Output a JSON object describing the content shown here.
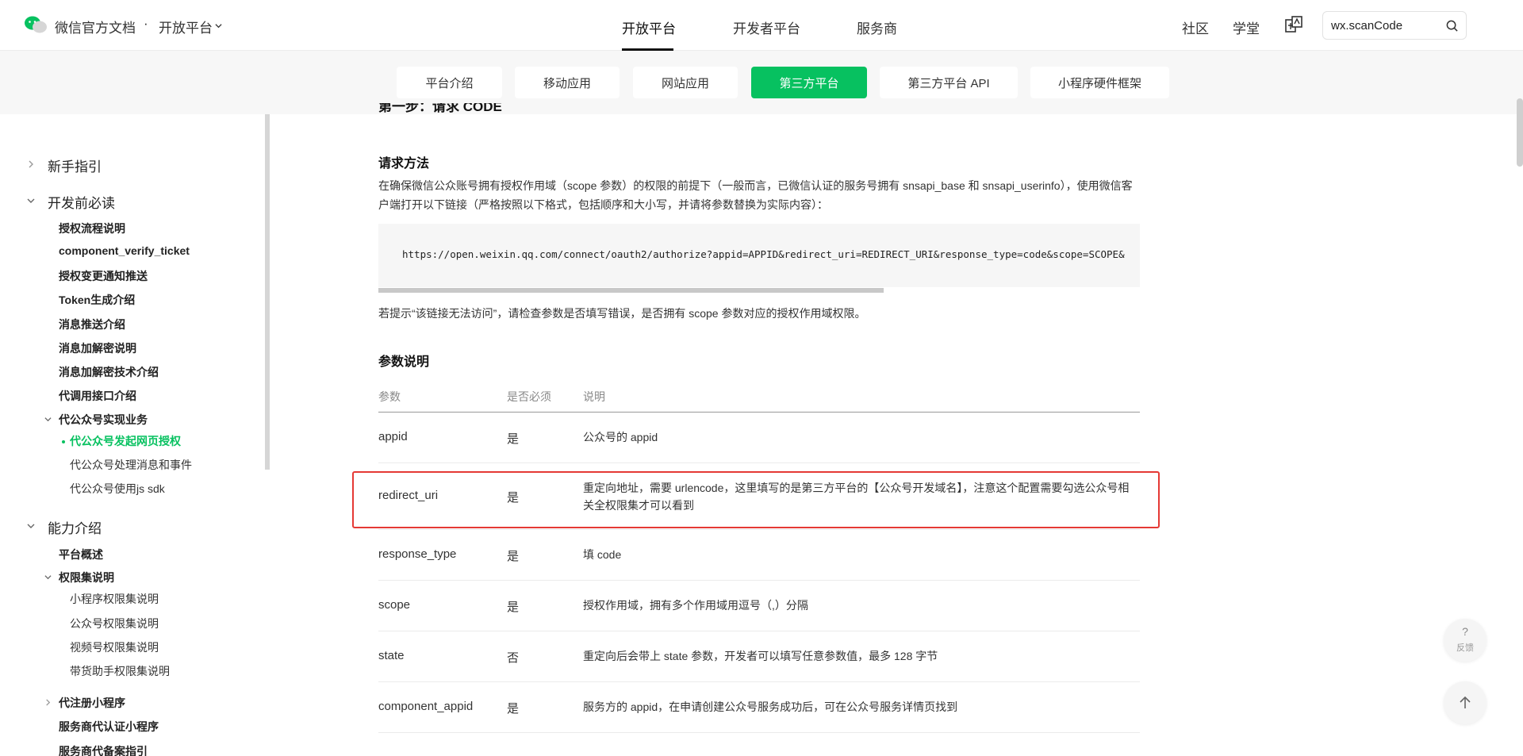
{
  "header": {
    "brand": "微信官方文档",
    "separator": "·",
    "platform": "开放平台",
    "nav": [
      "开放平台",
      "开发者平台",
      "服务商"
    ],
    "right_links": [
      "社区",
      "学堂"
    ],
    "search_value": "wx.scanCode"
  },
  "subtabs": [
    "平台介绍",
    "移动应用",
    "网站应用",
    "第三方平台",
    "第三方平台 API",
    "小程序硬件框架"
  ],
  "active_subtab": "第三方平台",
  "sidebar": {
    "sections": [
      "新手指引",
      "开发前必读",
      "能力介绍"
    ],
    "dev_items": [
      "授权流程说明",
      "component_verify_ticket",
      "授权变更通知推送",
      "Token生成介绍",
      "消息推送介绍",
      "消息加解密说明",
      "消息加解密技术介绍",
      "代调用接口介绍",
      "代公众号实现业务"
    ],
    "dev_subitems": [
      "代公众号发起网页授权",
      "代公众号处理消息和事件",
      "代公众号使用js sdk"
    ],
    "ability_items": [
      "平台概述",
      "权限集说明"
    ],
    "ability_subitems": [
      "小程序权限集说明",
      "公众号权限集说明",
      "视频号权限集说明",
      "带货助手权限集说明"
    ],
    "ability_more": [
      "代注册小程序",
      "服务商代认证小程序",
      "服务商代备案指引"
    ]
  },
  "content": {
    "cut_heading": "第一步：请求 CODE",
    "h_request": "请求方法",
    "p_request": "在确保微信公众账号拥有授权作用域（scope 参数）的权限的前提下（一般而言，已微信认证的服务号拥有 snsapi_base 和 snsapi_userinfo），使用微信客户端打开以下链接（严格按照以下格式，包括顺序和大小写，并请将参数替换为实际内容）：",
    "code": "https://open.weixin.qq.com/connect/oauth2/authorize?appid=APPID&redirect_uri=REDIRECT_URI&response_type=code&scope=SCOPE&",
    "p_hint": "若提示“该链接无法访问”，请检查参数是否填写错误，是否拥有 scope 参数对应的授权作用域权限。",
    "h_params": "参数说明",
    "table": {
      "headers": [
        "参数",
        "是否必须",
        "说明"
      ],
      "rows": [
        {
          "param": "appid",
          "required": "是",
          "desc": "公众号的 appid"
        },
        {
          "param": "redirect_uri",
          "required": "是",
          "desc": "重定向地址，需要 urlencode，这里填写的是第三方平台的【公众号开发域名】，注意这个配置需要勾选公众号相关全权限集才可以看到"
        },
        {
          "param": "response_type",
          "required": "是",
          "desc": "填 code"
        },
        {
          "param": "scope",
          "required": "是",
          "desc": "授权作用域，拥有多个作用域用逗号（,）分隔"
        },
        {
          "param": "state",
          "required": "否",
          "desc": "重定向后会带上 state 参数，开发者可以填写任意参数值，最多 128 字节"
        },
        {
          "param": "component_appid",
          "required": "是",
          "desc": "服务方的 appid，在申请创建公众号服务成功后，可在公众号服务详情页找到"
        }
      ]
    }
  },
  "float": {
    "feedback_q": "?",
    "feedback": "反馈"
  },
  "colors": {
    "accent": "#07c160",
    "highlight": "#e53935"
  }
}
